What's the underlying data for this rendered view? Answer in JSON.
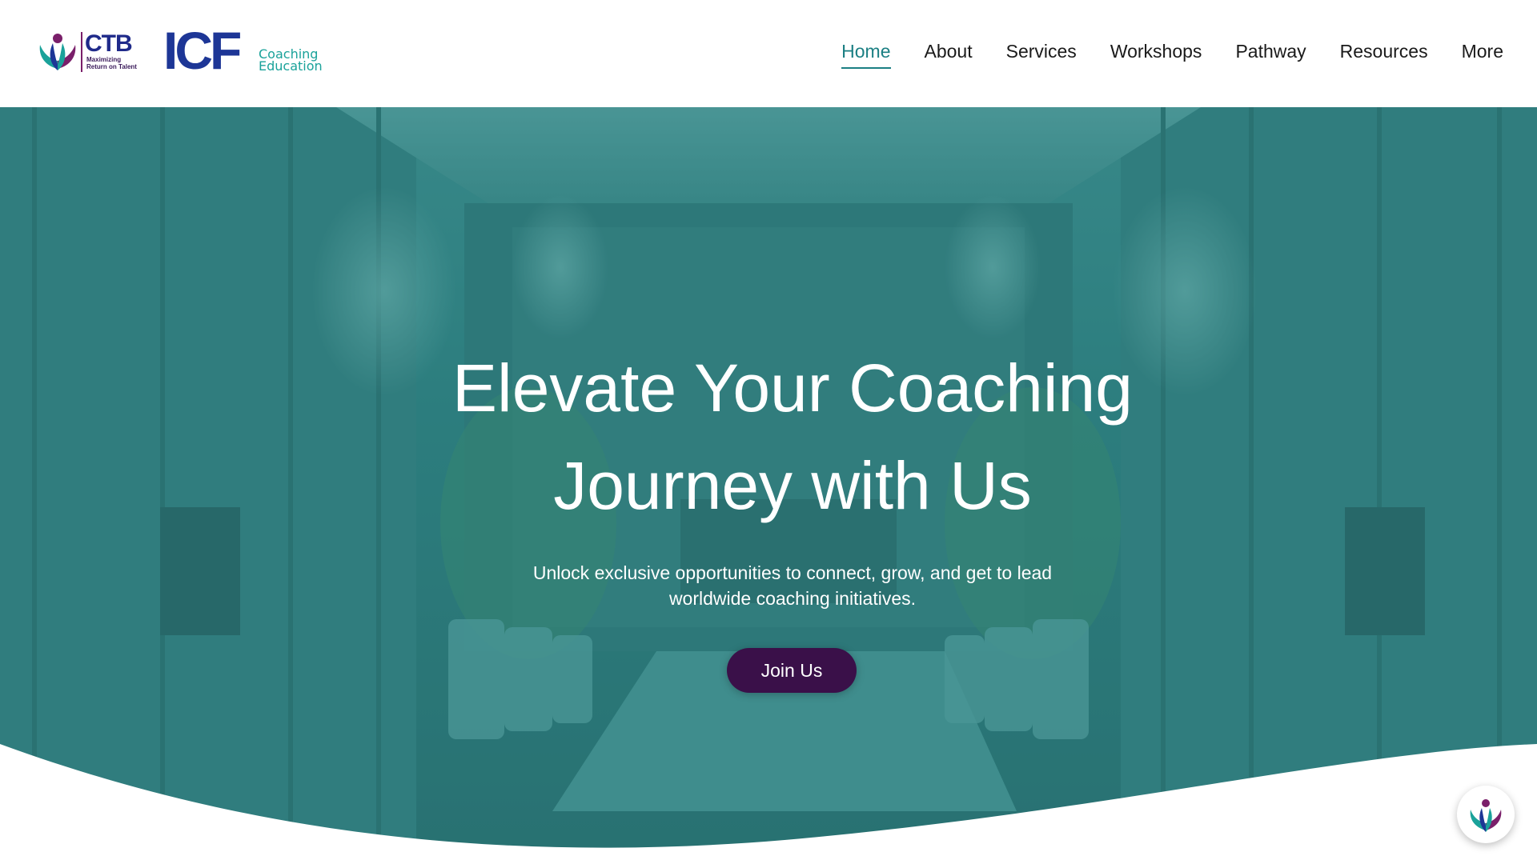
{
  "brand": {
    "ctb_name": "CTB",
    "ctb_tagline": "Maximizing Return on Talent",
    "icf_name": "ICF",
    "icf_sub_1": "Coaching",
    "icf_sub_2": "Education",
    "colors": {
      "teal": "#1aa29a",
      "navy": "#1d3696",
      "purple": "#3a1049"
    }
  },
  "nav": {
    "items": [
      {
        "label": "Home",
        "active": true
      },
      {
        "label": "About"
      },
      {
        "label": "Services"
      },
      {
        "label": "Workshops"
      },
      {
        "label": "Pathway"
      },
      {
        "label": "Resources"
      },
      {
        "label": "More"
      }
    ]
  },
  "hero": {
    "title_line1": "Elevate Your Coaching",
    "title_line2": "Journey with Us",
    "subtitle_line1": "Unlock exclusive opportunities to connect, grow, and get to lead",
    "subtitle_line2": "worldwide coaching initiatives.",
    "cta_label": "Join Us",
    "overlay_color": "#2d7f80"
  },
  "chat": {
    "icon": "ctb-logo-icon"
  }
}
